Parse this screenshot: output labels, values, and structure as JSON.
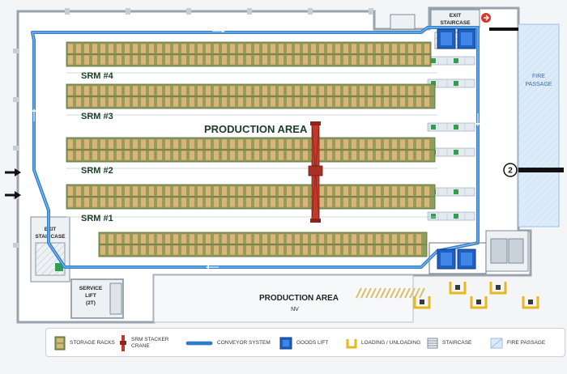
{
  "labels": {
    "exit_staircase_top_line1": "EXIT",
    "exit_staircase_top_line2": "STAIRCASE",
    "exit_staircase_left_line1": "EXIT",
    "exit_staircase_left_line2": "STAIRCASE",
    "fire_passage_line1": "FIRE",
    "fire_passage_line2": "PASSAGE",
    "srm4": "SRM #4",
    "srm3": "SRM #3",
    "srm2": "SRM #2",
    "srm1": "SRM #1",
    "production_area": "PRODUCTION AREA",
    "production_area_bottom": "PRODUCTION AREA",
    "production_area_bottom_sub": "NV",
    "service_lift_line1": "SERVICE",
    "service_lift_line2": "LIFT",
    "service_lift_line3": "(2T)",
    "marker_number": "2"
  },
  "legend": [
    {
      "key": "storage-racks",
      "label": "STORAGE RACKS"
    },
    {
      "key": "srm-stacker-crane",
      "label": "SRM STACKER CRANE"
    },
    {
      "key": "conveyor-system",
      "label": "CONVEYOR SYSTEM"
    },
    {
      "key": "goods-lift",
      "label": "GOODS LIFT"
    },
    {
      "key": "loading-unloading",
      "label": "LOADING / UNLOADING"
    },
    {
      "key": "staircase",
      "label": "STAIRCASE"
    },
    {
      "key": "fire-passage",
      "label": "FIRE PASSAGE"
    }
  ],
  "colors": {
    "rack": "#8aa05a",
    "pallet": "#d9b57a",
    "conveyor": "#2f7fd0",
    "crane": "#c0392b",
    "lift": "#1d5fc4",
    "loading": "#e6b81e",
    "fire": "#dcebfa",
    "text": "#1c3d28"
  }
}
